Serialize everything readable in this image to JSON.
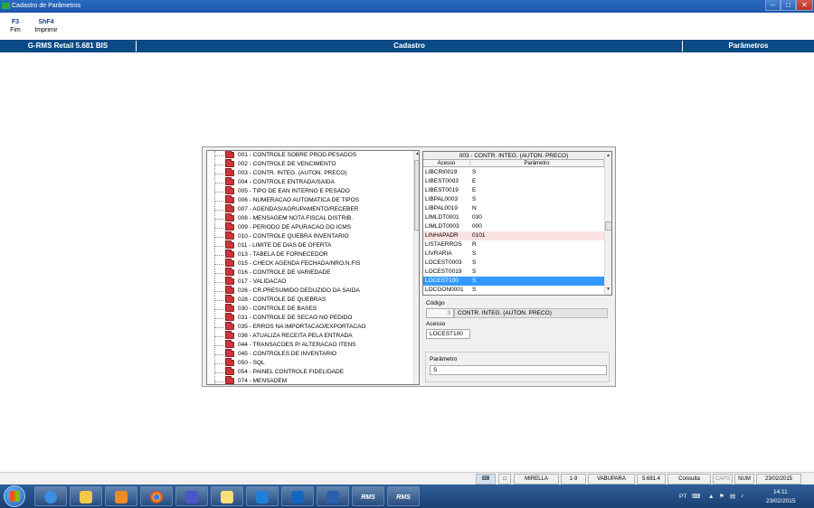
{
  "window": {
    "title": "Cadastro de Parâmetros"
  },
  "toolbar": {
    "fim": {
      "key": "F3",
      "label": "Fim"
    },
    "imprimir": {
      "key": "ShF4",
      "label": "Imprimir"
    }
  },
  "infobar": {
    "app": "G-RMS Retail 5.681 BIS",
    "section": "Cadastro",
    "module": "Parâmetros"
  },
  "tree": {
    "items": [
      "001 - CONTROLE SOBRE PROD.PESADOS",
      "002 - CONTROLE DE VENCIMENTO",
      "003 - CONTR. INTEG. (AUTON. PRECO)",
      "004 - CONTROLE ENTRADA/SAIDA",
      "005 - TIPO DE EAN INTERNO E PESADO",
      "006 - NUMERACAO AUTOMATICA DE TIPOS",
      "007 - AGENDAS/AGRUPAMENTO/RECEBER",
      "008 - MENSAGEM NOTA FISCAL DISTRIB.",
      "009 - PERIODO DE APURACAO DO ICMS",
      "010 - CONTROLE QUEBRA INVENTARIO",
      "011 - LIMITE DE DIAS DE OFERTA",
      "013 - TABELA DE FORNECEDOR",
      "015 - CHECK AGENDA FECHADA/NRO.N.FIS",
      "016 - CONTROLE DE VARIEDADE",
      "017 - VALIDACAO",
      "026 - CR.PRESUMIDO DEDUZIDO DA SAIDA",
      "028 - CONTROLE DE QUEBRAS",
      "030 - CONTROLE DE BASES",
      "031 - CONTROLE DE SECAO NO PEDIDO",
      "035 - ERROS NA IMPORTACAO/EXPORTACAO",
      "036 - ATUALIZA RECEITA PELA ENTRADA",
      "044 - TRANSACOES P/ ALTERACAO ITENS",
      "045 - CONTROLES DE INVENTARIO",
      "050 - SQL",
      "054 - PAINEL CONTROLE FIDELIDADE",
      "074 - MENSADEM"
    ]
  },
  "grid": {
    "title": "003 - CONTR. INTEG. (AUTON. PRECO)",
    "columns": [
      "Acesso",
      "Parâmetro"
    ],
    "rows": [
      [
        "LIBCRI0019",
        "S"
      ],
      [
        "LIBEST0003",
        "E"
      ],
      [
        "LIBEST0019",
        "E"
      ],
      [
        "LIBPAL0003",
        "S"
      ],
      [
        "LIBPAL0019",
        "N"
      ],
      [
        "LIMLDT0001",
        "030"
      ],
      [
        "LIMLDT0003",
        "000"
      ],
      [
        "LINHAPADR",
        "0101"
      ],
      [
        "LISTAERROS",
        "R"
      ],
      [
        "LIVRARIA",
        "S"
      ],
      [
        "LOCEST0003",
        "S"
      ],
      [
        "LOCEST0019",
        "S"
      ],
      [
        "LOCEST100",
        "S"
      ],
      [
        "LOCGON0001",
        "S"
      ]
    ],
    "selected_row": 12,
    "highlight_row": 7
  },
  "form": {
    "codigo_label": "Código",
    "codigo_value": "3",
    "codigo_desc": "CONTR. INTEG. (AUTON. PRECO)",
    "acesso_label": "Acesso",
    "acesso_value": "LOCEST100",
    "parametro_label": "Parâmetro",
    "parametro_value": "S"
  },
  "status": {
    "user": "MIRELLA",
    "company": "1-9",
    "store": "VABUPARA",
    "version": "5.681.4",
    "mode": "Consulta",
    "caps": "CAPS",
    "num": "NUM",
    "date": "23/02/2015"
  },
  "taskbar": {
    "rms1": "RMS",
    "rms2": "RMS",
    "lang": "PT",
    "time": "14:11",
    "date": "23/02/2015"
  },
  "colors": {
    "title_bar": "#1b56a8",
    "info_bar": "#0c4a86",
    "selected_row": "#3399ff",
    "folder": "#c9373d",
    "taskbar": "#1a3f73"
  }
}
